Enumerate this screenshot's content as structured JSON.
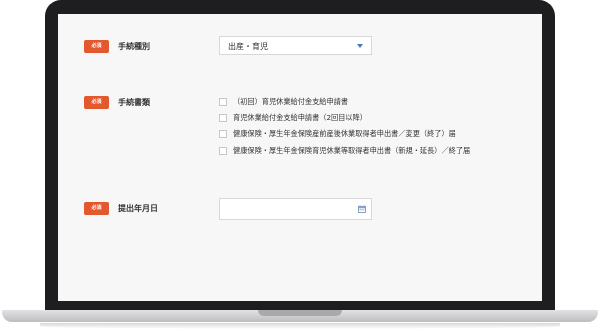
{
  "form": {
    "required_badge": "必須",
    "procedure_type": {
      "label": "手続種別",
      "selected": "出産・育児"
    },
    "procedure_documents": {
      "label": "手続書類",
      "options": [
        "（初回）育児休業給付金支給申請書",
        "育児休業給付金支給申請書（2回目以降）",
        "健康保険・厚生年金保険産前産後休業取得者申出書／変更（終了）届",
        "健康保険・厚生年金保険育児休業等取得者申出書（新規・延長）／終了届"
      ]
    },
    "submission_date": {
      "label": "提出年月日",
      "value": ""
    }
  },
  "colors": {
    "badge": "#e4582e",
    "caret": "#4a78b5",
    "screen_bg": "#f7f7f8",
    "bezel": "#1e1e20"
  }
}
